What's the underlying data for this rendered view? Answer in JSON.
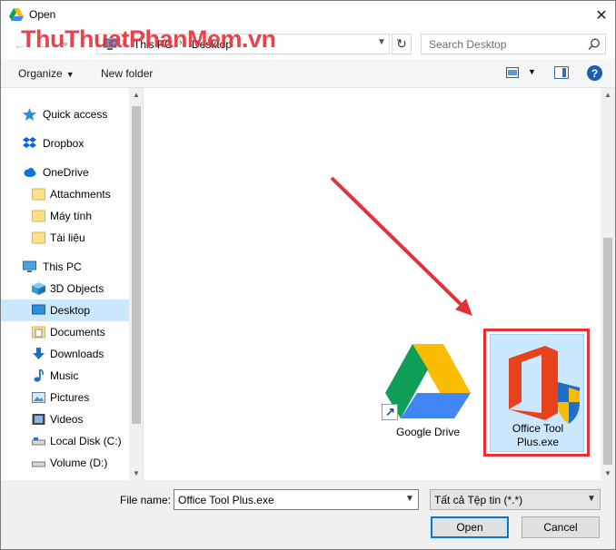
{
  "window": {
    "title": "Open",
    "close_glyph": "✕"
  },
  "watermark": "ThuThuatPhanMem.vn",
  "address": {
    "crumbs": [
      "This PC",
      "Desktop"
    ],
    "separator": "›",
    "search_placeholder": "Search Desktop"
  },
  "toolbar": {
    "organize": "Organize",
    "new_folder": "New folder",
    "help": "?"
  },
  "nav": {
    "items": [
      {
        "label": "Quick access",
        "icon": "star-icon"
      },
      {
        "label": "Dropbox",
        "icon": "dropbox-icon"
      },
      {
        "label": "OneDrive",
        "icon": "cloud-icon"
      },
      {
        "label": "Attachments",
        "icon": "folder-icon"
      },
      {
        "label": "Máy tính",
        "icon": "folder-icon"
      },
      {
        "label": "Tài liệu",
        "icon": "folder-icon"
      },
      {
        "label": "This PC",
        "icon": "pc-icon"
      },
      {
        "label": "3D Objects",
        "icon": "cube-icon"
      },
      {
        "label": "Desktop",
        "icon": "desktop-icon",
        "selected": true
      },
      {
        "label": "Documents",
        "icon": "documents-icon"
      },
      {
        "label": "Downloads",
        "icon": "download-icon"
      },
      {
        "label": "Music",
        "icon": "music-icon"
      },
      {
        "label": "Pictures",
        "icon": "pictures-icon"
      },
      {
        "label": "Videos",
        "icon": "videos-icon"
      },
      {
        "label": "Local Disk (C:)",
        "icon": "drive-icon"
      },
      {
        "label": "Volume (D:)",
        "icon": "drive-icon"
      }
    ]
  },
  "files": [
    {
      "label": "Google Drive",
      "icon": "google-drive-icon"
    },
    {
      "label": "Office Tool Plus.exe",
      "label_lines": [
        "Office Tool",
        "Plus.exe"
      ],
      "icon": "office-tool-plus-icon",
      "selected": true
    }
  ],
  "bottom": {
    "file_name_label": "File name:",
    "file_name_value": "Office Tool Plus.exe",
    "file_type_value": "Tất cả Tệp tin (*.*)",
    "open_label": "Open",
    "cancel_label": "Cancel"
  },
  "colors": {
    "accent": "#0078d7",
    "selection": "#cce8ff",
    "highlight_red": "#e5303a"
  }
}
